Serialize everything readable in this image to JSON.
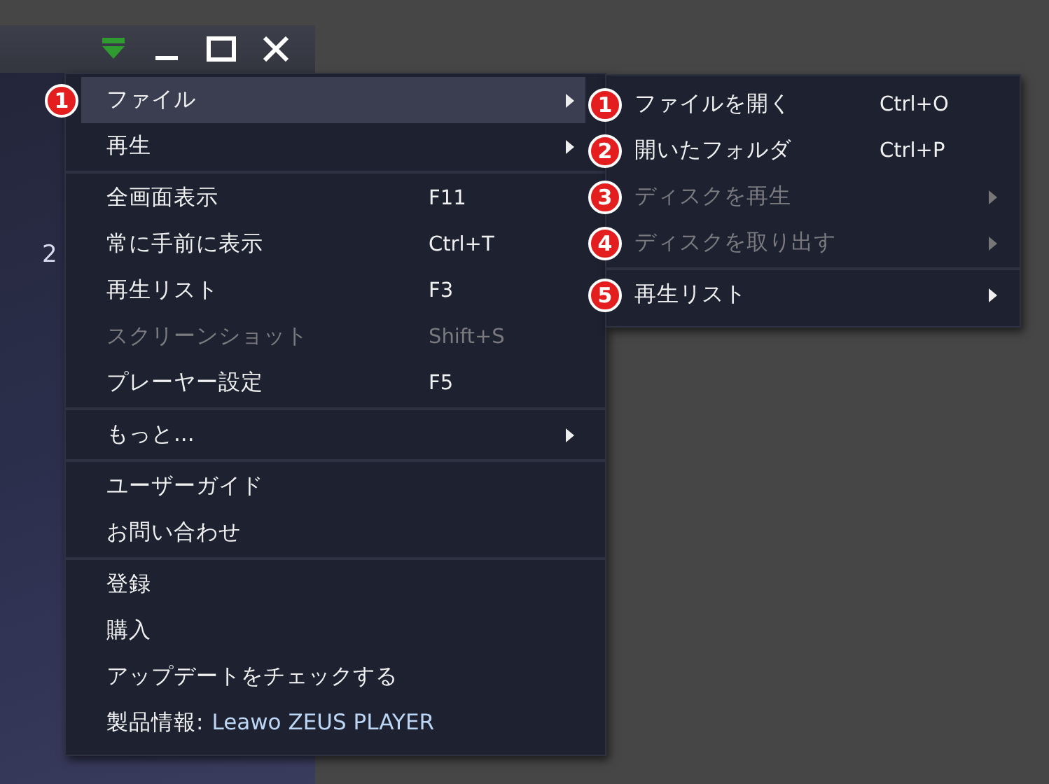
{
  "window": {
    "controls": [
      {
        "kind": "dropdown"
      },
      {
        "kind": "minimize"
      },
      {
        "kind": "maximize"
      },
      {
        "kind": "close"
      }
    ],
    "background_text": "2"
  },
  "menu": {
    "groups": [
      [
        {
          "label": "ファイル",
          "has_submenu": true,
          "selected": true,
          "disabled": false,
          "callout": "1"
        },
        {
          "label": "再生",
          "has_submenu": true,
          "selected": false,
          "disabled": false
        }
      ],
      [
        {
          "label": "全画面表示",
          "shortcut": "F11",
          "selected": false,
          "disabled": false
        },
        {
          "label": "常に手前に表示",
          "shortcut": "Ctrl+T",
          "selected": false,
          "disabled": false
        },
        {
          "label": "再生リスト",
          "shortcut": "F3",
          "selected": false,
          "disabled": false
        },
        {
          "label": "スクリーンショット",
          "shortcut": "Shift+S",
          "selected": false,
          "disabled": true
        },
        {
          "label": "プレーヤー設定",
          "shortcut": "F5",
          "selected": false,
          "disabled": false
        }
      ],
      [
        {
          "label": "もっと...",
          "has_submenu": true,
          "selected": false,
          "disabled": false
        }
      ],
      [
        {
          "label": "ユーザーガイド",
          "selected": false,
          "disabled": false
        },
        {
          "label": "お問い合わせ",
          "selected": false,
          "disabled": false
        }
      ],
      [
        {
          "label": "登録",
          "selected": false,
          "disabled": false
        },
        {
          "label": "購入",
          "selected": false,
          "disabled": false
        },
        {
          "label": "アップデートをチェックする",
          "selected": false,
          "disabled": false
        },
        {
          "label": "製品情報:",
          "detail": "Leawo ZEUS PLAYER",
          "selected": false,
          "disabled": false
        }
      ]
    ]
  },
  "submenu": {
    "groups": [
      [
        {
          "callout": "1",
          "label": "ファイルを開く",
          "shortcut": "Ctrl+O",
          "disabled": false
        },
        {
          "callout": "2",
          "label": "開いたフォルダ",
          "shortcut": "Ctrl+P",
          "disabled": false
        },
        {
          "callout": "3",
          "label": "ディスクを再生",
          "has_submenu": true,
          "disabled": true
        },
        {
          "callout": "4",
          "label": "ディスクを取り出す",
          "has_submenu": true,
          "disabled": true
        }
      ],
      [
        {
          "callout": "5",
          "label": "再生リスト",
          "has_submenu": true,
          "disabled": false
        }
      ]
    ]
  }
}
